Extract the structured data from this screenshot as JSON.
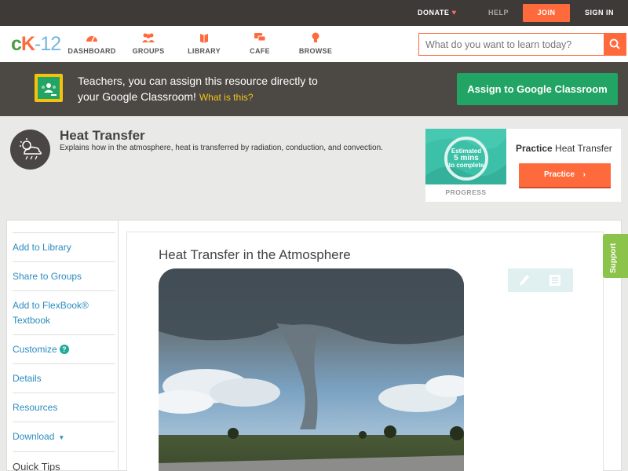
{
  "topbar": {
    "donate_label": "DONATE",
    "help_label": "HELP",
    "join_label": "JOIN",
    "signin_label": "SIGN IN"
  },
  "logo": {
    "part1": "c",
    "part2": "K",
    "part3": "-12"
  },
  "nav": {
    "items": [
      {
        "label": "DASHBOARD",
        "icon": "dashboard-gauge-icon"
      },
      {
        "label": "GROUPS",
        "icon": "groups-people-icon"
      },
      {
        "label": "LIBRARY",
        "icon": "library-book-icon"
      },
      {
        "label": "CAFE",
        "icon": "cafe-chat-icon"
      },
      {
        "label": "BROWSE",
        "icon": "browse-bulb-icon"
      }
    ],
    "search_placeholder": "What do you want to learn today?"
  },
  "classroom_banner": {
    "line1": "Teachers, you can assign this resource directly to",
    "line2": "your Google Classroom!",
    "what_link": "What is this?",
    "button_label": "Assign to Google Classroom"
  },
  "resource": {
    "title": "Heat Transfer",
    "description": "Explains how in the atmosphere, heat is transferred by radiation, conduction, and convection."
  },
  "practice": {
    "estimate_line1": "Estimated",
    "estimate_line2": "5 mins",
    "estimate_line3": "to complete",
    "progress_label": "PROGRESS",
    "title_bold": "Practice",
    "title_rest": "Heat Transfer",
    "button_label": "Practice"
  },
  "sidebar": {
    "items": [
      {
        "label": "Add to Library"
      },
      {
        "label": "Share to Groups"
      },
      {
        "label": "Add to FlexBook® Textbook"
      },
      {
        "label": "Customize"
      },
      {
        "label": "Details"
      },
      {
        "label": "Resources"
      },
      {
        "label": "Download"
      }
    ],
    "quick_tips": "Quick Tips"
  },
  "content": {
    "title": "Heat Transfer in the Atmosphere"
  },
  "support_tab": "Support",
  "colors": {
    "accent_orange": "#ff6a3d",
    "classroom_green": "#21a464",
    "link_blue": "#2a8bbf",
    "topbar_bg": "#3d3a38",
    "support_green": "#8cc34b"
  }
}
